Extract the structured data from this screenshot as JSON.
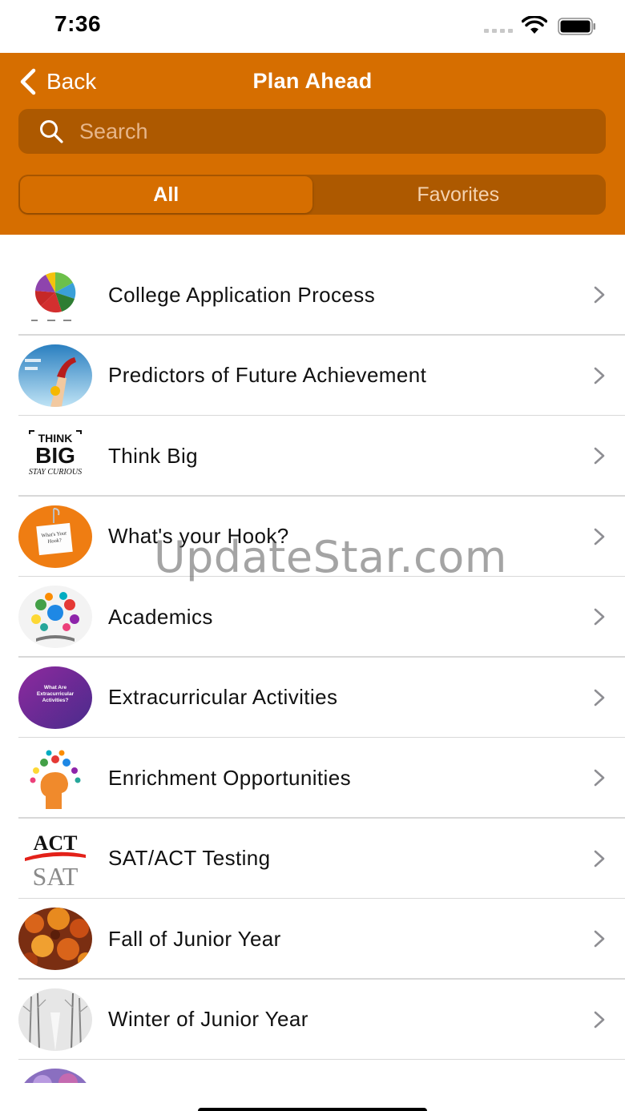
{
  "status_bar": {
    "time": "7:36"
  },
  "header": {
    "back_label": "Back",
    "title": "Plan Ahead",
    "search_placeholder": "Search",
    "segments": [
      {
        "label": "All",
        "active": true
      },
      {
        "label": "Favorites",
        "active": false
      }
    ]
  },
  "list": {
    "items": [
      {
        "label": "College Application Process",
        "thumb": "pie-chart-image"
      },
      {
        "label": "Predictors of Future Achievement",
        "thumb": "trophy-hand-image"
      },
      {
        "label": "Think Big",
        "thumb": "think-big-logo"
      },
      {
        "label": "What's your Hook?",
        "thumb": "hook-sign-image"
      },
      {
        "label": "Academics",
        "thumb": "academics-icons-image"
      },
      {
        "label": "Extracurricular Activities",
        "thumb": "extracurricular-image"
      },
      {
        "label": "Enrichment Opportunities",
        "thumb": "brain-ideas-image"
      },
      {
        "label": "SAT/ACT Testing",
        "thumb": "sat-act-logo"
      },
      {
        "label": "Fall of Junior Year",
        "thumb": "autumn-leaves-image"
      },
      {
        "label": "Winter of Junior Year",
        "thumb": "winter-trees-image"
      }
    ]
  },
  "thumb_text": {
    "think_big_1": "THINK",
    "think_big_2": "BIG",
    "think_big_3": "STAY CURIOUS",
    "hook": "What's Your Hook?",
    "extracurricular": "What Are Extracurricular Activities?",
    "act": "ACT",
    "sat": "SAT"
  },
  "watermark": "UpdateStar.com",
  "colors": {
    "accent": "#d66e00",
    "accent_dark": "#ad5900"
  }
}
